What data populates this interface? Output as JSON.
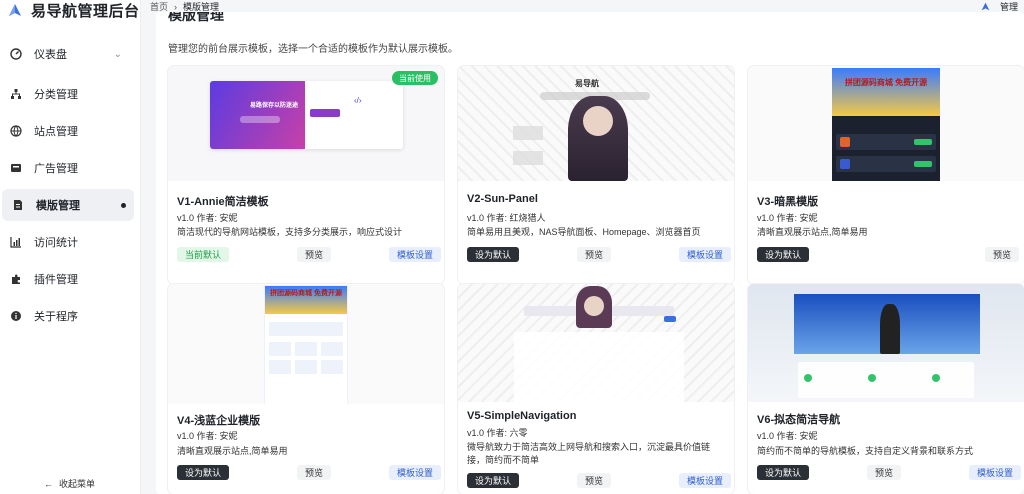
{
  "brand": {
    "title": "易导航管理后台"
  },
  "sidebar": {
    "items": [
      {
        "label": "仪表盘",
        "icon": "dashboard-icon"
      },
      {
        "label": "分类管理",
        "icon": "category-icon"
      },
      {
        "label": "站点管理",
        "icon": "globe-icon"
      },
      {
        "label": "广告管理",
        "icon": "ad-icon"
      },
      {
        "label": "模版管理",
        "icon": "template-icon"
      },
      {
        "label": "访问统计",
        "icon": "stats-icon"
      },
      {
        "label": "插件管理",
        "icon": "plugin-icon"
      },
      {
        "label": "关于程序",
        "icon": "info-icon"
      }
    ],
    "collapse_label": "收起菜单"
  },
  "breadcrumb": {
    "home": "首页",
    "current": "模版管理"
  },
  "user": {
    "name": "管理"
  },
  "page": {
    "title": "模版管理",
    "description": "管理您的前台展示模板，选择一个合适的模板作为默认展示模板。"
  },
  "templates": [
    {
      "title": "V1-Annie简洁模板",
      "meta": "v1.0  作者: 安妮",
      "desc": "简洁现代的导航网站模板，支持多分类展示，响应式设计",
      "status": "当前默认",
      "preview": "预览",
      "settings": "模板设置",
      "badge": "当前使用"
    },
    {
      "title": "V2-Sun-Panel",
      "meta": "v1.0  作者: 红烧猎人",
      "desc": "简单易用且美观，NAS导航面板、Homepage、浏览器首页",
      "status": "设为默认",
      "preview": "预览",
      "settings": "模板设置",
      "thumb_label": "易导航"
    },
    {
      "title": "V3-暗黑模版",
      "meta": "v1.0  作者: 安妮",
      "desc": "清晰直观展示站点,简单易用",
      "status": "设为默认",
      "preview": "预览"
    },
    {
      "title": "V4-浅蓝企业模版",
      "meta": "v1.0  作者: 安妮",
      "desc": "清晰直观展示站点,简单易用",
      "status": "设为默认",
      "preview": "预览",
      "settings": "模板设置"
    },
    {
      "title": "V5-SimpleNavigation",
      "meta": "v1.0  作者: 六零",
      "desc": "微导航致力于简洁高效上网导航和搜索入口，沉淀最具价值链接，简约而不简单",
      "status": "设为默认",
      "preview": "预览",
      "settings": "模板设置"
    },
    {
      "title": "V6-拟态简洁导航",
      "meta": "v1.0  作者: 安妮",
      "desc": "简约而不简单的导航模板，支持自定义背景和联系方式",
      "status": "设为默认",
      "preview": "预览",
      "settings": "模板设置"
    }
  ],
  "thumb_text": {
    "v1_banner": "易路保存以防迷途",
    "v3_promo": "拼团源码商城 免费开源",
    "v4_promo": "拼团源码商城 免费开源"
  },
  "colors": {
    "accent": "#2f5fd0",
    "dark_button": "#2b2f36",
    "badge_green": "#28c063"
  }
}
